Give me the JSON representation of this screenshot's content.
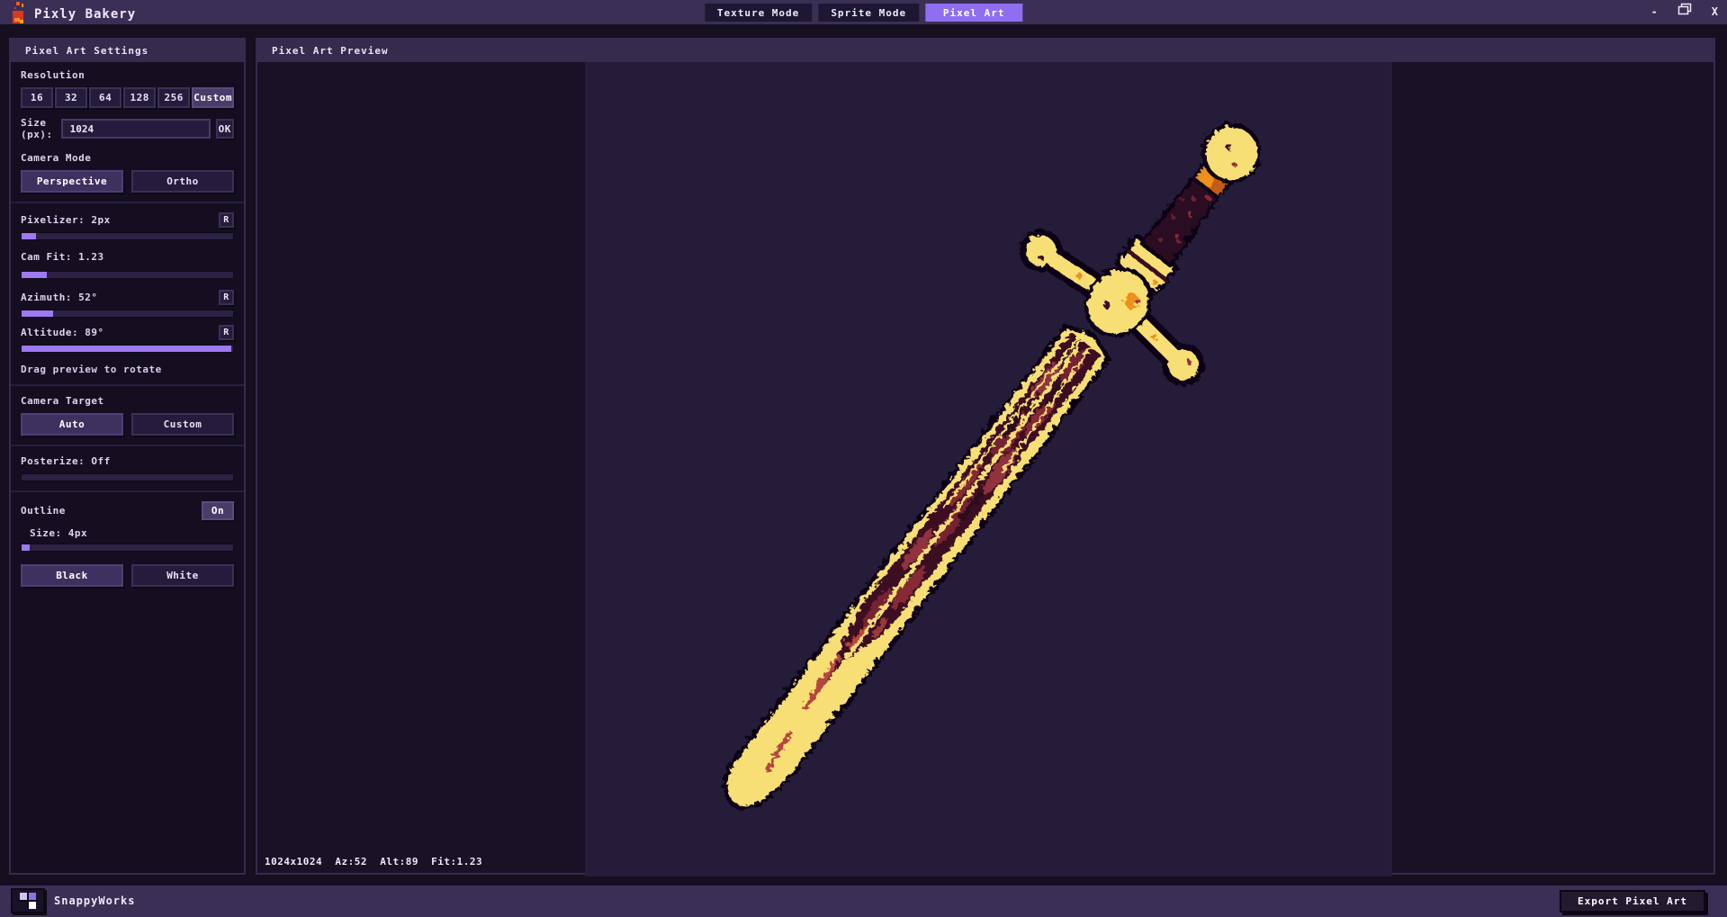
{
  "app": {
    "title": "Pixly Bakery",
    "controls": {
      "minimize": "-",
      "close": "X"
    }
  },
  "top_tabs": [
    {
      "label": "Texture Mode",
      "active": false
    },
    {
      "label": "Sprite Mode",
      "active": false
    },
    {
      "label": "Pixel Art",
      "active": true
    }
  ],
  "sidebar": {
    "header": "Pixel Art Settings",
    "resolution": {
      "label": "Resolution",
      "options": [
        "16",
        "32",
        "64",
        "128",
        "256",
        "Custom"
      ],
      "selected": "Custom"
    },
    "size": {
      "label": "Size (px):",
      "value": "1024",
      "ok_label": "OK"
    },
    "camera_mode": {
      "label": "Camera Mode",
      "options": [
        "Perspective",
        "Ortho"
      ],
      "selected": "Perspective"
    },
    "sliders": {
      "pixelizer": {
        "label": "Pixelizer: 2px",
        "reset_label": "R",
        "fill_pct": 7
      },
      "cam_fit": {
        "label": "Cam Fit: 1.23",
        "fill_pct": 12
      },
      "azimuth": {
        "label": "Azimuth: 52°",
        "reset_label": "R",
        "fill_pct": 15
      },
      "altitude": {
        "label": "Altitude: 89°",
        "reset_label": "R",
        "fill_pct": 99
      }
    },
    "hint": "Drag preview to rotate",
    "camera_target": {
      "label": "Camera Target",
      "options": [
        "Auto",
        "Custom"
      ],
      "selected": "Auto"
    },
    "posterize": {
      "label": "Posterize: Off",
      "fill_pct": 0
    },
    "outline": {
      "label": "Outline",
      "toggle_label": "On",
      "size_label": "Size: 4px",
      "size_fill_pct": 4,
      "color_options": [
        "Black",
        "White"
      ],
      "selected_color": "Black"
    }
  },
  "preview": {
    "header": "Pixel Art Preview",
    "status": "1024x1024  Az:52  Alt:89  Fit:1.23",
    "subject": "pixel-art sword"
  },
  "footer": {
    "brand": "SnappyWorks",
    "export_label": "Export Pixel Art"
  },
  "colors": {
    "accent_purple": "#8f6ff0",
    "slider_fill": "#9d79f2",
    "titlebar_bg": "#3b2f55",
    "panel_bg": "#150e20",
    "viewport_bg": "#241c38",
    "sword_yellow": "#f7df76",
    "sword_orange": "#ef8f1c",
    "sword_maroon": "#3c1124",
    "sword_red": "#96333e",
    "outline_black": "#0b0613"
  }
}
